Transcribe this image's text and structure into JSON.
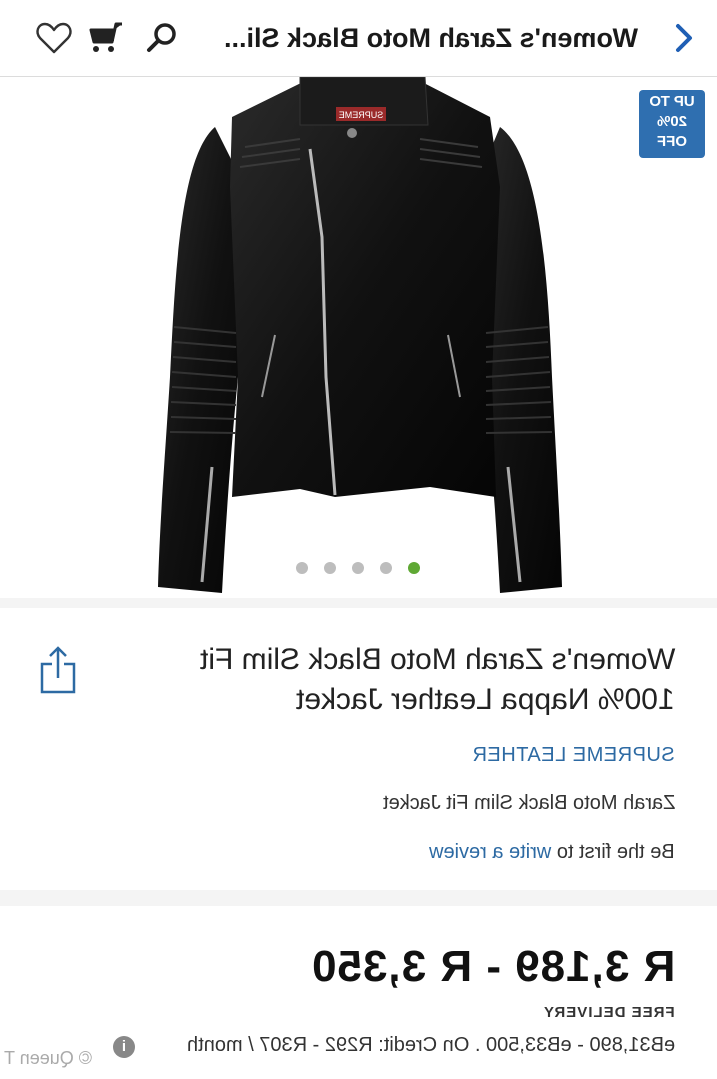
{
  "header": {
    "title": "Women's Zarah Moto Black Sli...",
    "back_icon": "chevron-left-icon",
    "search_icon": "search-icon",
    "cart_icon": "cart-icon",
    "wishlist_icon": "heart-icon"
  },
  "hero": {
    "badge": [
      "UP TO",
      "20%",
      "OFF"
    ],
    "jacket_label": "SUPREME",
    "carousel_dots": 5,
    "active_dot_index": 4
  },
  "product": {
    "title_line1": "Women's Zarah Moto Black Slim Fit",
    "title_line2": "100% Nappa Leather Jacket",
    "brand": "SUPREME LEATHER",
    "subtitle": "Zarah Moto Black Slim Fit Jacket",
    "review_prefix": "Be the first to ",
    "review_link": "write a review",
    "share_icon": "share-icon"
  },
  "price": {
    "range": "R 3,189 - R 3,350",
    "delivery": "FREE DELIVERY",
    "credit": "eB31,890 - eB33,500 . On Credit: R292 - R307 / month",
    "info_icon": "i"
  },
  "watermark": "© Queen T",
  "colors": {
    "accent": "#2d6aa3",
    "badge": "#2f6fb0",
    "active_dot": "#5fa834"
  }
}
